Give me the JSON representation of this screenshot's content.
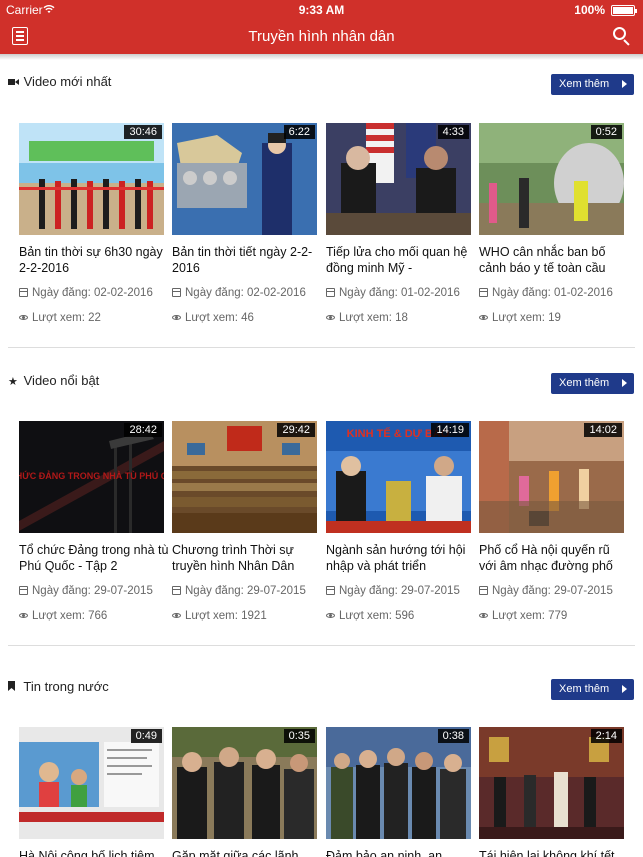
{
  "status": {
    "carrier": "Carrier",
    "time": "9:33 AM",
    "battery": "100%"
  },
  "header": {
    "title": "Truyền hình nhân dân"
  },
  "sections": [
    {
      "title": "Video mới nhất",
      "icon": "video-camera-icon",
      "more": "Xem thêm",
      "items": [
        {
          "title": "Bản tin thời sự 6h30 ngày 2-2-2016",
          "duration": "30:46",
          "date": "Ngày đăng: 02-02-2016",
          "views": "Lượt xem: 22"
        },
        {
          "title": "Bản tin thời tiết ngày 2-2-2016",
          "duration": "6:22",
          "date": "Ngày đăng: 02-02-2016",
          "views": "Lượt xem: 46"
        },
        {
          "title": "Tiếp lửa cho mối quan hệ đồng minh Mỹ -",
          "duration": "4:33",
          "date": "Ngày đăng: 01-02-2016",
          "views": "Lượt xem: 18"
        },
        {
          "title": "WHO cân nhắc ban bố cảnh báo y tế toàn cầu",
          "duration": "0:52",
          "date": "Ngày đăng: 01-02-2016",
          "views": "Lượt xem: 19"
        }
      ]
    },
    {
      "title": "Video nổi bật",
      "icon": "star-icon",
      "more": "Xem thêm",
      "items": [
        {
          "title": "Tổ chức Đảng trong nhà tù Phú Quốc - Tập 2",
          "duration": "28:42",
          "date": "Ngày đăng: 29-07-2015",
          "views": "Lượt xem: 766"
        },
        {
          "title": "Chương trình Thời sự truyền hình Nhân Dân",
          "duration": "29:42",
          "date": "Ngày đăng: 29-07-2015",
          "views": "Lượt xem: 1921"
        },
        {
          "title": "Ngành sản hướng tới hội nhập và phát triển",
          "duration": "14:19",
          "date": "Ngày đăng: 29-07-2015",
          "views": "Lượt xem: 596"
        },
        {
          "title": "Phố cổ Hà nội quyến rũ với âm nhạc đường phố",
          "duration": "14:02",
          "date": "Ngày đăng: 29-07-2015",
          "views": "Lượt xem: 779"
        }
      ]
    },
    {
      "title": "Tin trong nước",
      "icon": "bookmark-icon",
      "more": "Xem thêm",
      "items": [
        {
          "title": "Hà Nội công bố lịch tiêm",
          "duration": "0:49"
        },
        {
          "title": "Gặp mặt giữa các lãnh",
          "duration": "0:35"
        },
        {
          "title": "Đảm bảo an ninh, an",
          "duration": "0:38"
        },
        {
          "title": "Tái hiện lại không khí tết",
          "duration": "2:14"
        }
      ]
    }
  ],
  "thumb_overlay": {
    "hoi_ngay": "TỔ CHỨC ĐẢNG TRONG NHÀ TÙ PHÚ QUỐC",
    "kinh_te": "KINH TẾ & DỰ BÁO"
  }
}
